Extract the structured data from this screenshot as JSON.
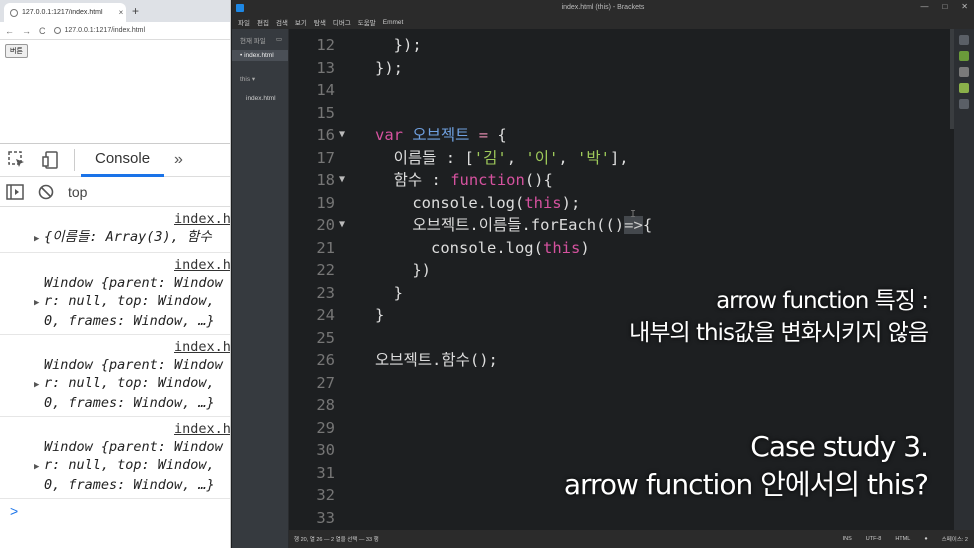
{
  "browser": {
    "tab_title": "127.0.0.1:1217/index.html",
    "tab_close": "×",
    "new_tab": "+",
    "back": "←",
    "forward": "→",
    "reload": "C",
    "address": "127.0.0.1:1217/index.html",
    "page_button": "버튼"
  },
  "devtools": {
    "console_tab": "Console",
    "more_tabs": "»",
    "context": "top",
    "logs": [
      {
        "src": "index.h",
        "lines": [
          "{이름들: Array(3), 함수"
        ]
      },
      {
        "src": "index.h",
        "lines": [
          "Window {parent: Window",
          "r: null, top: Window,",
          "0, frames: Window, …}"
        ]
      },
      {
        "src": "index.h",
        "lines": [
          "Window {parent: Window",
          "r: null, top: Window,",
          "0, frames: Window, …}"
        ]
      },
      {
        "src": "index.h",
        "lines": [
          "Window {parent: Window",
          "r: null, top: Window,",
          "0, frames: Window, …}"
        ]
      }
    ],
    "prompt": ">"
  },
  "brackets": {
    "window_title": "index.html (this) - Brackets",
    "menu": [
      "파일",
      "편집",
      "검색",
      "보기",
      "탐색",
      "디버그",
      "도움말",
      "Emmet"
    ],
    "sidebar": {
      "working_files_label": "현재 파일",
      "working_file": "index.html",
      "project": "this",
      "project_file": "index.html"
    },
    "status": {
      "position": "행 20, 열 26 — 2 열을 선택 — 33 행",
      "ins": "INS",
      "encoding": "UTF-8",
      "language": "HTML",
      "spaces": "스페이스: 2"
    }
  },
  "code_lines": [
    {
      "n": "12",
      "fold": "",
      "html": "  });"
    },
    {
      "n": "13",
      "fold": "",
      "html": "});"
    },
    {
      "n": "14",
      "fold": "",
      "html": ""
    },
    {
      "n": "15",
      "fold": "",
      "html": ""
    },
    {
      "n": "16",
      "fold": "▼",
      "html": "<span class='kw'>var</span> <span class='vr'>오브젝트</span> <span class='op'>=</span> {"
    },
    {
      "n": "17",
      "fold": "",
      "html": "  이름들 : [<span class='str'>'김'</span>, <span class='str'>'이'</span>, <span class='str'>'박'</span>],"
    },
    {
      "n": "18",
      "fold": "▼",
      "html": "  함수 : <span class='fn'>function</span>(){"
    },
    {
      "n": "19",
      "fold": "",
      "html": "    console.log(<span class='this'>this</span>);"
    },
    {
      "n": "20",
      "fold": "▼",
      "html": "    오브젝트.이름들.forEach(()<span class='arrow-sel'>=></span>{"
    },
    {
      "n": "21",
      "fold": "",
      "html": "      console.log(<span class='this'>this</span>)"
    },
    {
      "n": "22",
      "fold": "",
      "html": "    })"
    },
    {
      "n": "23",
      "fold": "",
      "html": "  }"
    },
    {
      "n": "24",
      "fold": "",
      "html": "}"
    },
    {
      "n": "25",
      "fold": "",
      "html": ""
    },
    {
      "n": "26",
      "fold": "",
      "html": "오브젝트.함수();"
    },
    {
      "n": "27",
      "fold": "",
      "html": ""
    },
    {
      "n": "28",
      "fold": "",
      "html": ""
    },
    {
      "n": "29",
      "fold": "",
      "html": ""
    },
    {
      "n": "30",
      "fold": "",
      "html": ""
    },
    {
      "n": "31",
      "fold": "",
      "html": ""
    },
    {
      "n": "32",
      "fold": "",
      "html": ""
    },
    {
      "n": "33",
      "fold": "",
      "html": ""
    }
  ],
  "captions": {
    "top_line1": "arrow function 특징 :",
    "top_line2": "내부의 this값을 변화시키지 않음",
    "bottom_line1": "Case study 3.",
    "bottom_line2": "arrow function 안에서의 this?"
  }
}
